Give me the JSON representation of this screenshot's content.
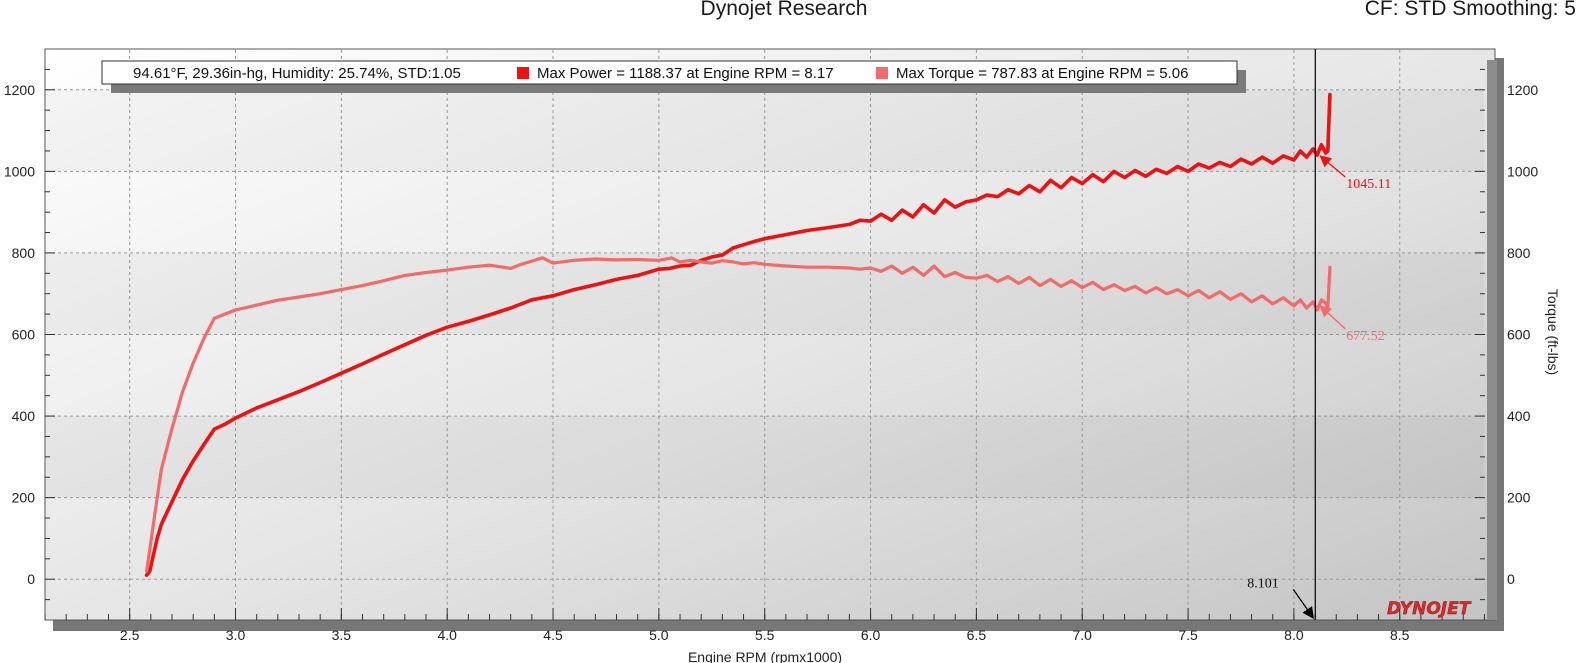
{
  "header": {
    "title": "Dynojet Research",
    "cf_label": "CF: STD Smoothing: 5"
  },
  "brand": {
    "logo_text": "DYNOJET"
  },
  "colors": {
    "power": "#ee1111",
    "torque": "#f26a6a",
    "cursor": "#000000",
    "brand": "#d82a2a"
  },
  "chart_data": {
    "type": "line",
    "title": "Dynojet Research",
    "xlabel": "Engine RPM (rpmx1000)",
    "ylabel_right": "Torque (ft-lbs)",
    "xlim": [
      2.1,
      8.95
    ],
    "ylim": [
      -100,
      1300
    ],
    "x_ticks": [
      "2.5",
      "3.0",
      "3.5",
      "4.0",
      "4.5",
      "5.0",
      "5.5",
      "6.0",
      "6.5",
      "7.0",
      "7.5",
      "8.0",
      "8.5"
    ],
    "y_ticks": [
      "0",
      "200",
      "400",
      "600",
      "800",
      "1000",
      "1200"
    ],
    "grid": true,
    "legend": {
      "conditions": "94.61°F, 29.36in-hg, Humidity: 25.74%, STD:1.05",
      "power_entry": "Max Power = 1188.37 at Engine RPM = 8.17",
      "torque_entry": "Max Torque = 787.83 at Engine RPM = 5.06",
      "placement": "top"
    },
    "cursor": {
      "x": 8.101,
      "label": "8.101"
    },
    "annotations": {
      "power_value": "1045.11",
      "torque_value": "677.52"
    },
    "series": [
      {
        "name": "Max Power",
        "color": "#ee1111",
        "x": [
          2.58,
          2.595,
          2.61,
          2.63,
          2.65,
          2.7,
          2.75,
          2.8,
          2.85,
          2.9,
          2.95,
          3.0,
          3.1,
          3.2,
          3.3,
          3.4,
          3.5,
          3.6,
          3.7,
          3.8,
          3.9,
          4.0,
          4.1,
          4.2,
          4.3,
          4.4,
          4.45,
          4.5,
          4.6,
          4.7,
          4.8,
          4.9,
          5.0,
          5.05,
          5.1,
          5.15,
          5.2,
          5.25,
          5.3,
          5.35,
          5.4,
          5.45,
          5.5,
          5.6,
          5.7,
          5.8,
          5.9,
          5.95,
          6.0,
          6.05,
          6.1,
          6.15,
          6.2,
          6.25,
          6.3,
          6.35,
          6.4,
          6.45,
          6.5,
          6.55,
          6.6,
          6.65,
          6.7,
          6.75,
          6.8,
          6.85,
          6.9,
          6.95,
          7.0,
          7.05,
          7.1,
          7.15,
          7.2,
          7.25,
          7.3,
          7.35,
          7.4,
          7.45,
          7.5,
          7.55,
          7.6,
          7.65,
          7.7,
          7.75,
          7.8,
          7.85,
          7.9,
          7.95,
          8.0,
          8.03,
          8.06,
          8.09,
          8.11,
          8.13,
          8.15,
          8.16,
          8.17
        ],
        "y": [
          10,
          20,
          55,
          100,
          135,
          190,
          245,
          290,
          330,
          368,
          380,
          395,
          420,
          440,
          460,
          482,
          505,
          528,
          552,
          575,
          598,
          618,
          632,
          648,
          665,
          685,
          690,
          695,
          710,
          722,
          735,
          745,
          760,
          762,
          768,
          770,
          782,
          790,
          795,
          812,
          820,
          828,
          835,
          845,
          855,
          862,
          870,
          880,
          878,
          895,
          880,
          905,
          888,
          918,
          898,
          930,
          912,
          925,
          930,
          942,
          938,
          955,
          945,
          965,
          950,
          978,
          960,
          985,
          970,
          992,
          975,
          1000,
          985,
          1002,
          988,
          1005,
          995,
          1012,
          1000,
          1018,
          1008,
          1022,
          1012,
          1030,
          1018,
          1035,
          1020,
          1038,
          1028,
          1050,
          1035,
          1055,
          1040,
          1065,
          1045.11,
          1050,
          1188.37
        ]
      },
      {
        "name": "Max Torque",
        "color": "#f26a6a",
        "x": [
          2.58,
          2.6,
          2.63,
          2.65,
          2.7,
          2.75,
          2.8,
          2.85,
          2.9,
          2.95,
          3.0,
          3.1,
          3.2,
          3.3,
          3.4,
          3.5,
          3.6,
          3.7,
          3.8,
          3.9,
          4.0,
          4.1,
          4.2,
          4.3,
          4.35,
          4.4,
          4.45,
          4.5,
          4.6,
          4.7,
          4.8,
          4.9,
          5.0,
          5.06,
          5.1,
          5.15,
          5.2,
          5.25,
          5.3,
          5.35,
          5.4,
          5.45,
          5.5,
          5.6,
          5.7,
          5.8,
          5.9,
          5.95,
          6.0,
          6.05,
          6.1,
          6.15,
          6.2,
          6.25,
          6.3,
          6.35,
          6.4,
          6.45,
          6.5,
          6.55,
          6.6,
          6.65,
          6.7,
          6.75,
          6.8,
          6.85,
          6.9,
          6.95,
          7.0,
          7.05,
          7.1,
          7.15,
          7.2,
          7.25,
          7.3,
          7.35,
          7.4,
          7.45,
          7.5,
          7.55,
          7.6,
          7.65,
          7.7,
          7.75,
          7.8,
          7.85,
          7.9,
          7.95,
          8.0,
          8.03,
          8.06,
          8.09,
          8.11,
          8.13,
          8.15,
          8.16,
          8.17
        ],
        "y": [
          20,
          90,
          200,
          270,
          370,
          460,
          530,
          590,
          640,
          650,
          660,
          672,
          684,
          692,
          700,
          710,
          720,
          732,
          745,
          752,
          758,
          765,
          770,
          762,
          772,
          780,
          788,
          775,
          782,
          785,
          783,
          784,
          782,
          787.83,
          778,
          782,
          778,
          775,
          781,
          778,
          773,
          776,
          772,
          768,
          765,
          765,
          763,
          760,
          763,
          755,
          768,
          750,
          765,
          745,
          768,
          742,
          752,
          740,
          738,
          745,
          730,
          742,
          725,
          740,
          720,
          735,
          718,
          732,
          715,
          728,
          710,
          722,
          708,
          718,
          702,
          715,
          700,
          710,
          695,
          708,
          690,
          705,
          686,
          700,
          680,
          695,
          675,
          690,
          670,
          685,
          665,
          680,
          660,
          685,
          677.52,
          665,
          765
        ]
      }
    ]
  }
}
